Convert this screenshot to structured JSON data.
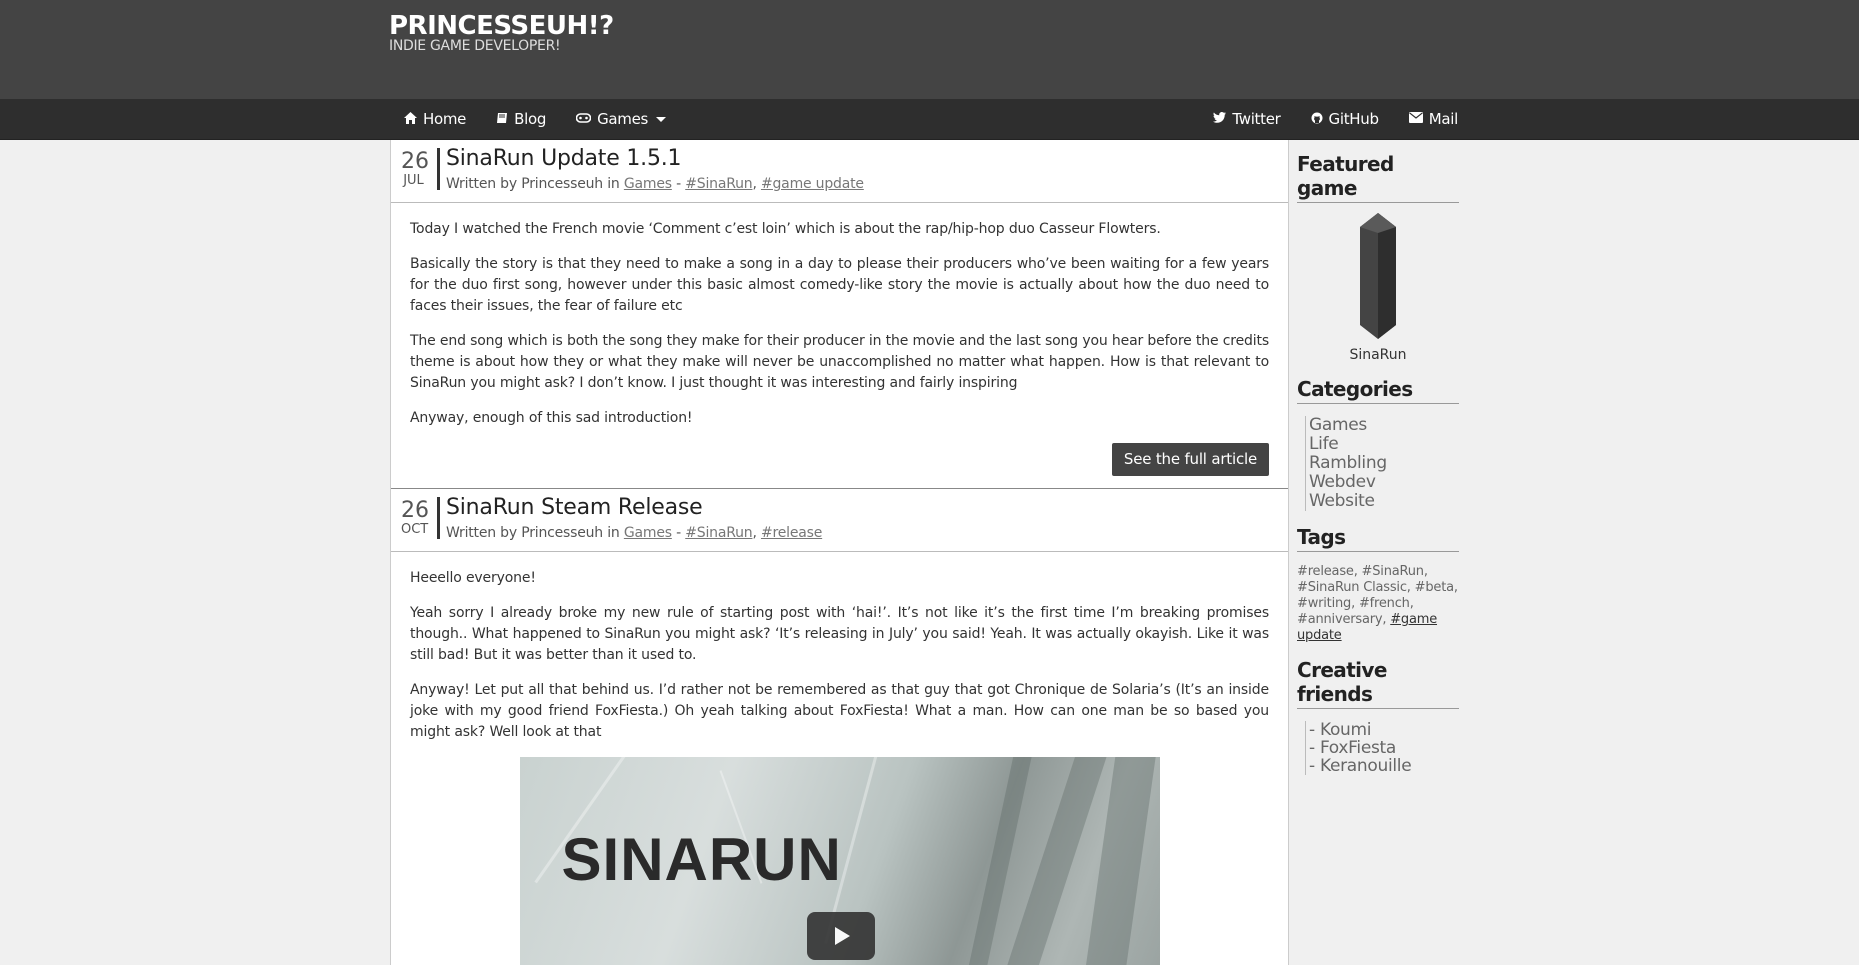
{
  "brand": {
    "title": "PRINCESSEUH!?",
    "subtitle": "INDIE GAME DEVELOPER!"
  },
  "nav": {
    "left": [
      {
        "label": "Home",
        "icon": "home-icon"
      },
      {
        "label": "Blog",
        "icon": "book-icon"
      },
      {
        "label": "Games",
        "icon": "gamepad-icon"
      }
    ],
    "right": [
      {
        "label": "Twitter",
        "icon": "twitter-icon"
      },
      {
        "label": "GitHub",
        "icon": "github-icon"
      },
      {
        "label": "Mail",
        "icon": "envelope-icon"
      }
    ]
  },
  "posts": [
    {
      "day": "26",
      "month": "JUL",
      "title": "SinaRun Update 1.5.1",
      "meta_prefix": "Written by Princesseuh in",
      "category": "Games",
      "separator": "-",
      "tags": [
        "#SinaRun",
        "#game update"
      ],
      "paragraphs": [
        "Today I watched the French movie ‘Comment c’est loin’ which is about the rap/hip-hop duo Casseur Flowters.",
        "Basically the story is that they need to make a song in a day to please their producers who’ve been waiting for a few years for the duo first song, however under this basic almost comedy-like story the movie is actually about how the duo need to faces their issues, the fear of failure etc",
        "The end song which is both the song they make for their producer in the movie and the last song you hear before the credits theme is about how they or what they make will never be unaccomplished no matter what happen. How is that relevant to SinaRun you might ask? I don’t know. I just thought it was interesting and fairly inspiring",
        "Anyway, enough of this sad introduction!"
      ],
      "button": "See the full article"
    },
    {
      "day": "26",
      "month": "OCT",
      "title": "SinaRun Steam Release",
      "meta_prefix": "Written by Princesseuh in",
      "category": "Games",
      "separator": "-",
      "tags": [
        "#SinaRun",
        "#release"
      ],
      "paragraphs": [
        "Heeello everyone!",
        "Yeah sorry I already broke my new rule of starting post with ‘hai!’. It’s not like it’s the first time I’m breaking promises though.. What happened to SinaRun you might ask? ‘It’s releasing in July’ you said! Yeah. It was actually okayish. Like it was still bad! But it was better than it used to.",
        "Anyway! Let put all that behind us. I’d rather not be remembered as that guy that got Chronique de Solaria’s (It’s an inside joke with my good friend FoxFiesta.) Oh yeah talking about FoxFiesta! What a man. How can one man be so based you might ask? Well look at that"
      ],
      "video_logo": "SINARUN"
    }
  ],
  "sidebar": {
    "featured_heading": "Featured game",
    "featured_name": "SinaRun",
    "categories_heading": "Categories",
    "categories": [
      "Games",
      "Life",
      "Rambling",
      "Webdev",
      "Website"
    ],
    "tags_heading": "Tags",
    "tags_plain": "#release, #SinaRun, #SinaRun Classic, #beta, #writing, #french, #anniversary,",
    "tags_link": "#game update",
    "friends_heading": "Creative friends",
    "friends": [
      "- Koumi",
      "- FoxFiesta",
      "- Keranouille"
    ]
  },
  "colors": {
    "header": "#444444",
    "navbar": "#2e2e2e",
    "button": "#444444",
    "background": "#f0f0f0"
  }
}
